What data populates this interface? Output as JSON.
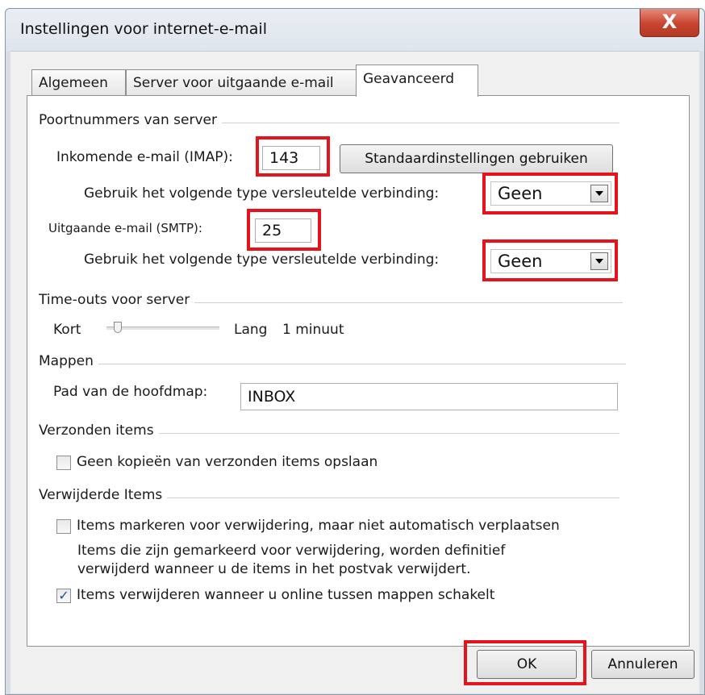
{
  "window": {
    "title": "Instellingen voor internet-e-mail",
    "close_label": "X"
  },
  "tabs": [
    {
      "label": "Algemeen",
      "active": false
    },
    {
      "label": "Server voor uitgaande e-mail",
      "active": false
    },
    {
      "label": "Geavanceerd",
      "active": true
    }
  ],
  "server_ports": {
    "group_label": "Poortnummers van server",
    "incoming_label": "Inkomende e-mail (IMAP):",
    "incoming_value": "143",
    "default_button": "Standaardinstellingen gebruiken",
    "incoming_encryption_label": "Gebruik het volgende type versleutelde verbinding:",
    "incoming_encryption_value": "Geen",
    "outgoing_label": "Uitgaande e-mail (SMTP):",
    "outgoing_value": "25",
    "outgoing_encryption_label": "Gebruik het volgende type versleutelde verbinding:",
    "outgoing_encryption_value": "Geen"
  },
  "timeouts": {
    "group_label": "Time-outs voor server",
    "short_label": "Kort",
    "long_label": "Lang",
    "value_label": "1 minuut",
    "slider_level": 0.1
  },
  "folders": {
    "group_label": "Mappen",
    "root_path_label": "Pad van de hoofdmap:",
    "root_path_value": "INBOX"
  },
  "sent_items": {
    "group_label": "Verzonden items",
    "no_copies_label": "Geen kopieën van verzonden items opslaan",
    "no_copies_checked": false
  },
  "deleted_items": {
    "group_label": "Verwijderde Items",
    "mark_label": "Items markeren voor verwijdering, maar niet automatisch verplaatsen",
    "mark_checked": false,
    "info_line1": "Items die zijn gemarkeerd voor verwijdering, worden definitief",
    "info_line2": "verwijderd wanneer u de items in het postvak verwijdert.",
    "purge_label": "Items verwijderen wanneer u online tussen mappen schakelt",
    "purge_checked": true
  },
  "footer": {
    "ok_label": "OK",
    "cancel_label": "Annuleren"
  },
  "colors": {
    "highlight": "#e3141b",
    "check": "#1a4fa0"
  }
}
